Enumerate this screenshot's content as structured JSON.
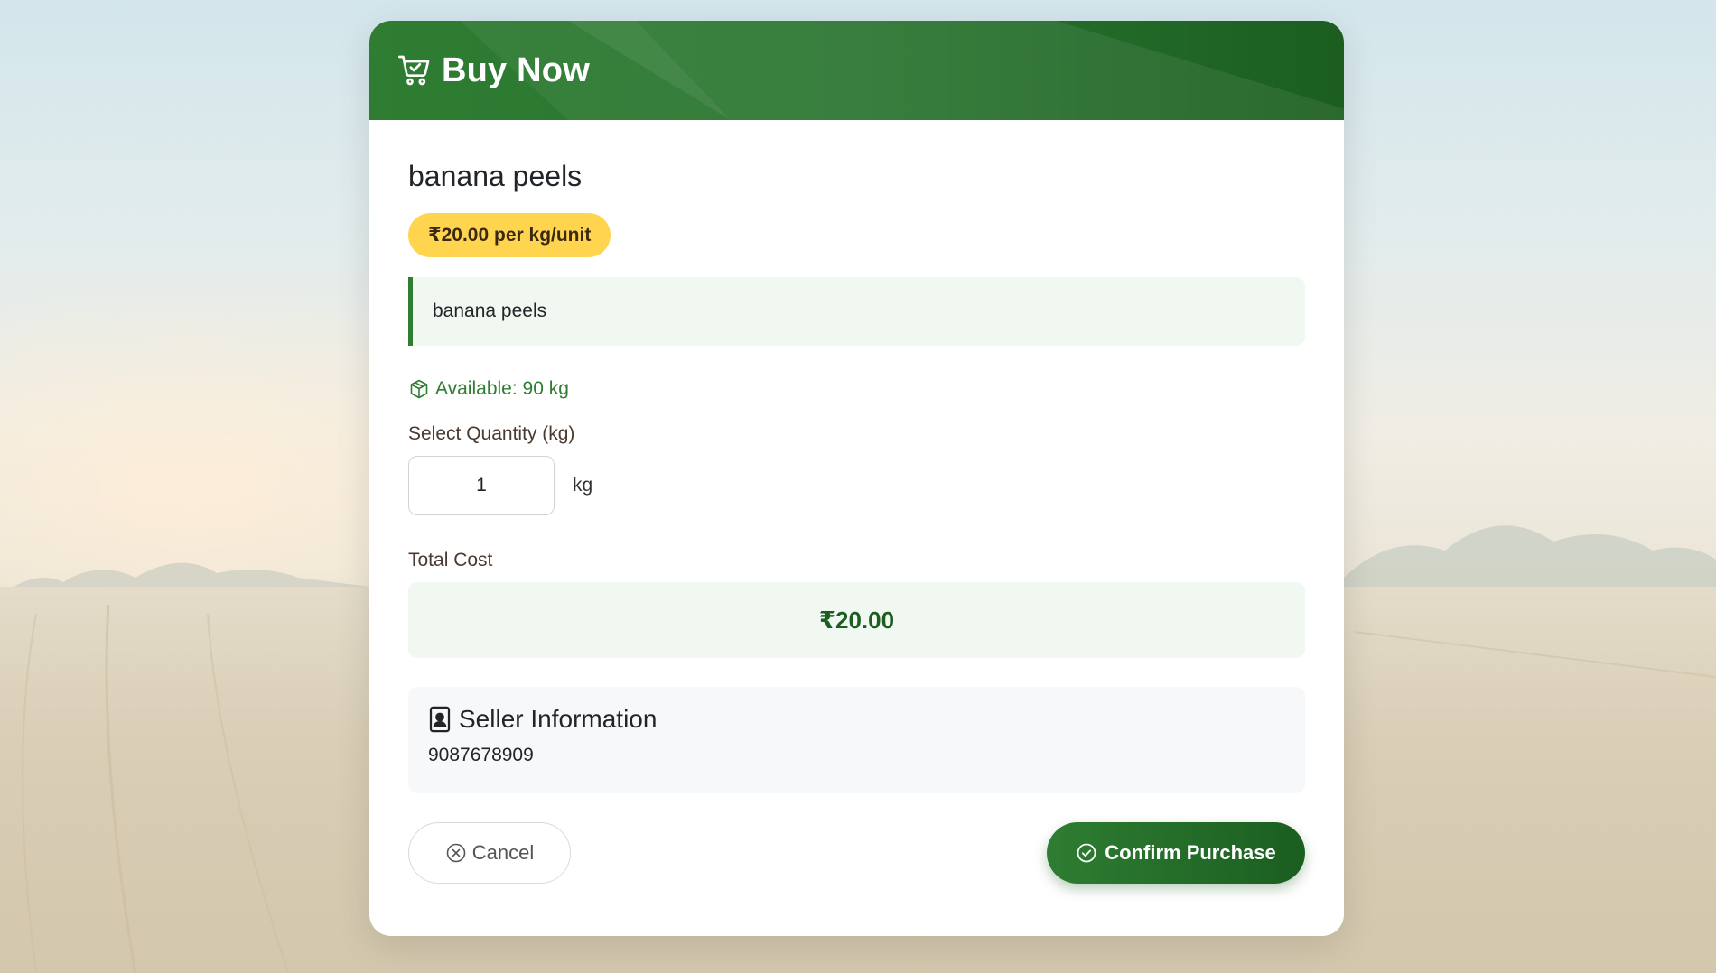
{
  "header": {
    "title": "Buy Now",
    "icon": "cart-check-icon",
    "color_start": "#2e7d32",
    "color_end": "#1b5e20"
  },
  "product": {
    "name": "banana peels",
    "price_label": "₹20.00 per kg/unit",
    "description": "banana peels",
    "availability": "Available: 90 kg"
  },
  "quantity": {
    "label": "Select Quantity (kg)",
    "value": "1",
    "unit": "kg"
  },
  "total": {
    "label": "Total Cost",
    "value": "₹20.00"
  },
  "seller": {
    "title": "Seller Information",
    "phone": "9087678909"
  },
  "actions": {
    "cancel_label": "Cancel",
    "confirm_label": "Confirm Purchase"
  },
  "colors": {
    "accent": "#2e7d32",
    "badge": "#ffd54f"
  }
}
